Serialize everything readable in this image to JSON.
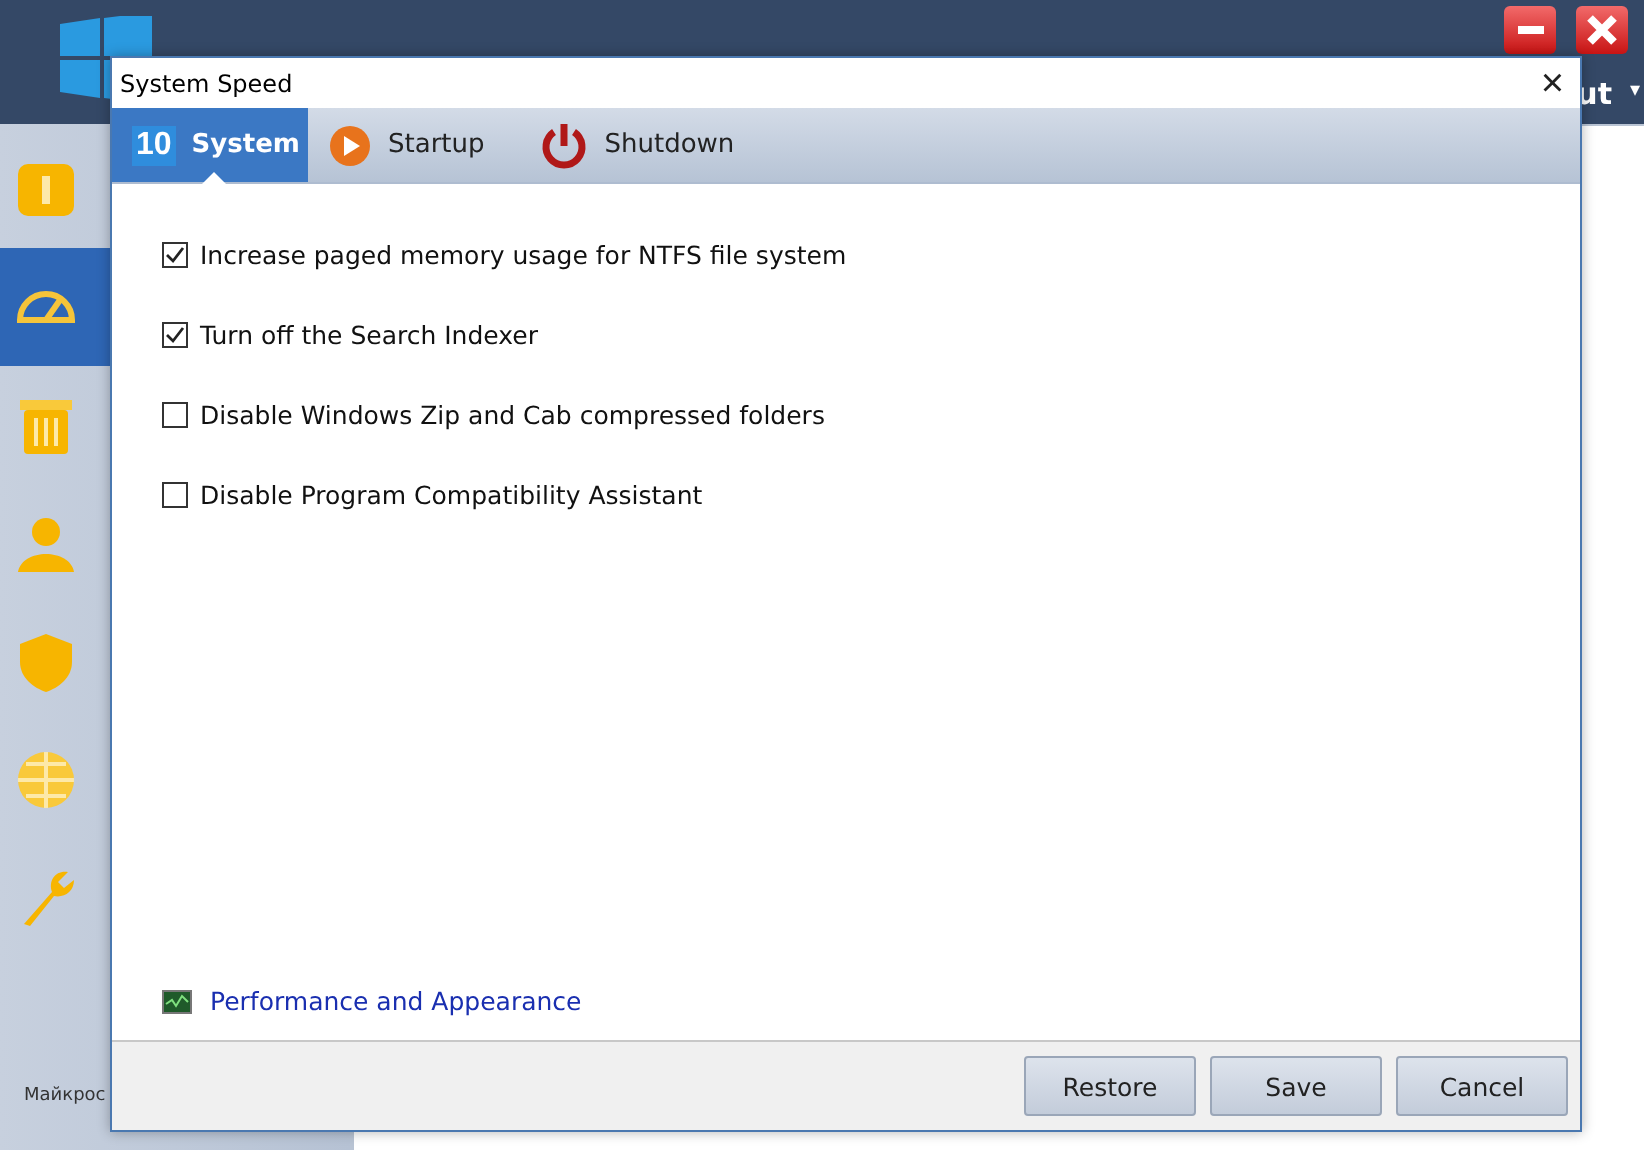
{
  "app": {
    "menu_text": "ut",
    "menu_caret": "▾",
    "footer": "Майкрос"
  },
  "sidebar": {
    "items": [
      {
        "kind": "info",
        "selected": false
      },
      {
        "kind": "gauge",
        "selected": true
      },
      {
        "kind": "trash",
        "selected": false
      },
      {
        "kind": "user",
        "selected": false
      },
      {
        "kind": "shield",
        "selected": false
      },
      {
        "kind": "globe",
        "selected": false
      },
      {
        "kind": "wrench",
        "selected": false
      }
    ]
  },
  "dialog": {
    "title": "System Speed",
    "close": "×",
    "tabs": [
      {
        "label": "System",
        "kind": "windows",
        "badge": "10",
        "selected": true
      },
      {
        "label": "Startup",
        "kind": "play",
        "selected": false
      },
      {
        "label": "Shutdown",
        "kind": "power",
        "selected": false
      }
    ],
    "options": [
      {
        "label": "Increase paged memory usage for NTFS file system",
        "checked": true
      },
      {
        "label": "Turn off the Search Indexer",
        "checked": true
      },
      {
        "label": "Disable Windows Zip and Cab compressed folders",
        "checked": false
      },
      {
        "label": "Disable Program Compatibility Assistant",
        "checked": false
      }
    ],
    "link": "Performance and Appearance",
    "buttons": [
      "Restore",
      "Save",
      "Cancel"
    ]
  }
}
